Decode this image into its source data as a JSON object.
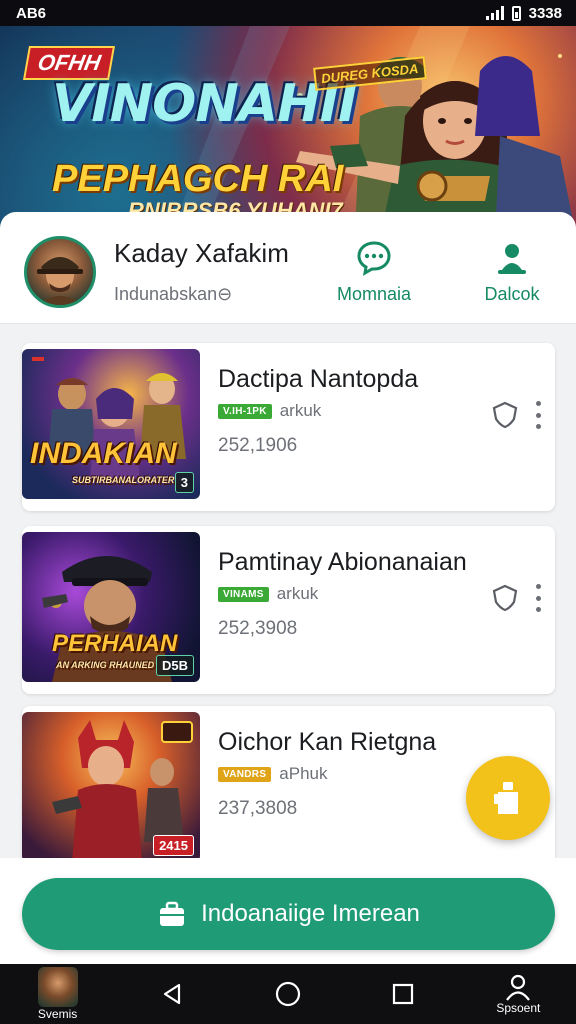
{
  "status_bar": {
    "left_text": "AB6",
    "time": "3338"
  },
  "banner": {
    "tag": "OFHH",
    "title": "VINONAHII",
    "subtitle1": "PEPHAGCH RAI",
    "subtitle2": "RNIBRSB6 YUHANI7",
    "badge": "DUREG KOSDA"
  },
  "profile": {
    "name": "Kaday Xafakim",
    "handle": "Indunabskan⊖",
    "actions": [
      {
        "label": "Momnaia",
        "icon": "chat-bubble-icon"
      },
      {
        "label": "Dalcok",
        "icon": "person-pin-icon"
      }
    ]
  },
  "games": [
    {
      "title": "Dactipa Nantopda",
      "tag": "V.IH-1PK",
      "meta": "arkuk",
      "count": "252,1906",
      "thumb_text": "INDAKIAN",
      "thumb_subtext": "SUBTIRBANALORATER",
      "thumb_badge": "3",
      "tag_color": "#3aa935"
    },
    {
      "title": "Pamtinay Abionanaian",
      "tag": "VINAMS",
      "meta": "arkuk",
      "count": "252,3908",
      "thumb_text": "PERHAIAN",
      "thumb_subtext": "AN ARKING RHAUNED",
      "thumb_badge": "D5B",
      "tag_color": "#3aa935"
    },
    {
      "title": "Oichor Kan Rietgna",
      "tag": "VANDRS",
      "meta": "aPhuk",
      "count": "237,3808",
      "thumb_text": "",
      "thumb_subtext": "",
      "thumb_badge": "2415",
      "tag_color": "#e0a419"
    }
  ],
  "main_button": {
    "label": "Indoanaiige Imerean"
  },
  "nav": {
    "left_label": "Svemis",
    "right_label": "Spsoent"
  }
}
